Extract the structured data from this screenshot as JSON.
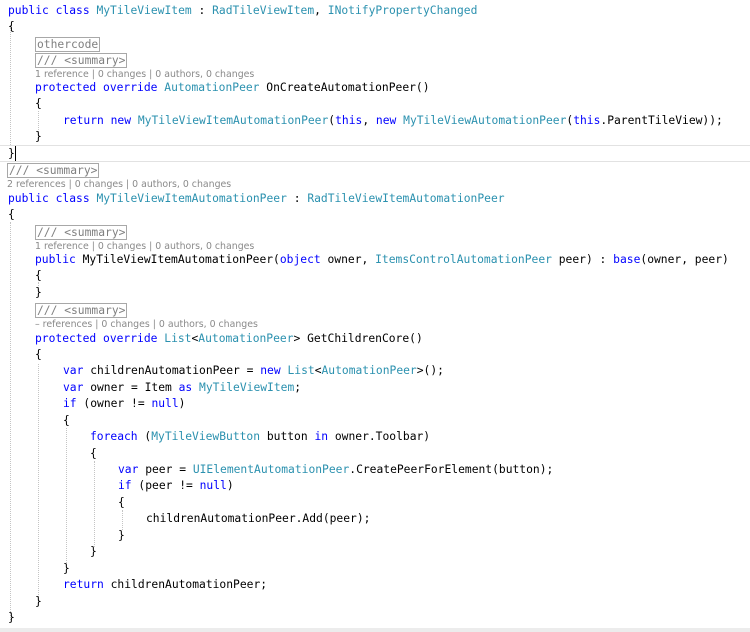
{
  "code": {
    "l01": {
      "kw1": "public",
      "kw2": "class",
      "name": "MyTileViewItem",
      "colon": ":",
      "base1": "RadTileViewItem",
      "comma": ",",
      "base2": "INotifyPropertyChanged"
    },
    "l02": {
      "brace": "{"
    },
    "l03": {
      "region": "othercode"
    },
    "l04": {
      "doc": "/// <summary>"
    },
    "lens1": "1 reference | 0 changes | 0 authors, 0 changes",
    "l05": {
      "kw1": "protected",
      "kw2": "override",
      "type": "AutomationPeer",
      "name": "OnCreateAutomationPeer()"
    },
    "l06": {
      "brace": "{"
    },
    "l07": {
      "kw1": "return",
      "kw2": "new",
      "type1": "MyTileViewItemAutomationPeer",
      "p1": "(",
      "kw3": "this",
      "p2": ", ",
      "kw4": "new",
      "type2": "MyTileViewAutomationPeer",
      "p3": "(",
      "kw5": "this",
      "p4": ".ParentTileView));"
    },
    "l08": {
      "brace": "}"
    },
    "l09": {
      "brace": "}"
    },
    "l10": {
      "doc": "/// <summary>"
    },
    "lens2": "2 references | 0 changes | 0 authors, 0 changes",
    "l11": {
      "kw1": "public",
      "kw2": "class",
      "name": "MyTileViewItemAutomationPeer",
      "colon": ":",
      "base": "RadTileViewItemAutomationPeer"
    },
    "l12": {
      "brace": "{"
    },
    "l13": {
      "doc": "/// <summary>"
    },
    "lens3": "1 reference | 0 changes | 0 authors, 0 changes",
    "l14": {
      "kw1": "public",
      "name": "MyTileViewItemAutomationPeer(",
      "kw2": "object",
      "p1": " owner, ",
      "type": "ItemsControlAutomationPeer",
      "p2": " peer) : ",
      "kw3": "base",
      "p3": "(owner, peer)"
    },
    "l15": {
      "brace": "{"
    },
    "l16": {
      "brace": "}"
    },
    "l17": {
      "doc": "/// <summary>"
    },
    "lens4": "– references | 0 changes | 0 authors, 0 changes",
    "l18": {
      "kw1": "protected",
      "kw2": "override",
      "type1": "List",
      "lt": "<",
      "type2": "AutomationPeer",
      "gt": ">",
      "name": " GetChildrenCore()"
    },
    "l19": {
      "brace": "{"
    },
    "l20": {
      "kw1": "var",
      "p1": " childrenAutomationPeer = ",
      "kw2": "new",
      "type1": "List",
      "lt": "<",
      "type2": "AutomationPeer",
      "p2": ">();"
    },
    "l21": {
      "kw1": "var",
      "p1": " owner = Item ",
      "kw2": "as",
      "type": "MyTileViewItem",
      "p2": ";"
    },
    "l22": {
      "kw1": "if",
      "p1": " (owner != ",
      "kw2": "null",
      "p2": ")"
    },
    "l23": {
      "brace": "{"
    },
    "l24": {
      "kw1": "foreach",
      "p1": " (",
      "type": "MyTileViewButton",
      "p2": " button ",
      "kw2": "in",
      "p3": " owner.Toolbar)"
    },
    "l25": {
      "brace": "{"
    },
    "l26": {
      "kw1": "var",
      "p1": " peer = ",
      "type": "UIElementAutomationPeer",
      "p2": ".CreatePeerForElement(button);"
    },
    "l27": {
      "kw1": "if",
      "p1": " (peer != ",
      "kw2": "null",
      "p2": ")"
    },
    "l28": {
      "brace": "{"
    },
    "l29": {
      "text": "childrenAutomationPeer.Add(peer);"
    },
    "l30": {
      "brace": "}"
    },
    "l31": {
      "brace": "}"
    },
    "l32": {
      "brace": "}"
    },
    "l33": {
      "kw1": "return",
      "p1": " childrenAutomationPeer;"
    },
    "l34": {
      "brace": "}"
    },
    "l35": {
      "brace": "}"
    }
  },
  "colors": {
    "keyword": "#0000ff",
    "type": "#2b91af",
    "comment": "#808080",
    "text": "#000000",
    "lens": "#8a8a8a"
  }
}
